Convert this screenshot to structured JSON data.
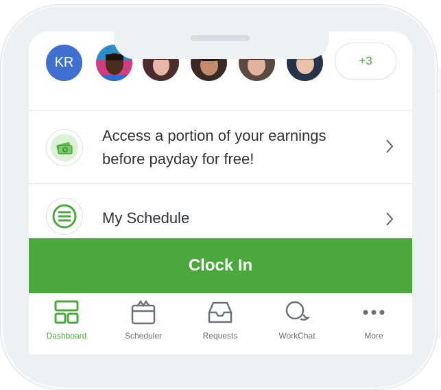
{
  "avatars": {
    "initials": "KR",
    "overflow_count": "+3"
  },
  "rows": [
    {
      "id": "earnings",
      "line1": "Access a portion of your earnings",
      "line2": "before payday for free!"
    },
    {
      "id": "schedule",
      "line1": "My Schedule",
      "line2": ""
    }
  ],
  "clock_in_label": "Clock In",
  "tabs": [
    {
      "label": "Dashboard",
      "icon": "dashboard-icon",
      "active": true
    },
    {
      "label": "Scheduler",
      "icon": "scheduler-icon",
      "active": false
    },
    {
      "label": "Requests",
      "icon": "requests-icon",
      "active": false
    },
    {
      "label": "WorkChat",
      "icon": "workchat-icon",
      "active": false
    },
    {
      "label": "More",
      "icon": "more-icon",
      "active": false
    }
  ],
  "colors": {
    "accent_green": "#4aa83c",
    "initials_avatar_blue": "#3f6fd1"
  }
}
